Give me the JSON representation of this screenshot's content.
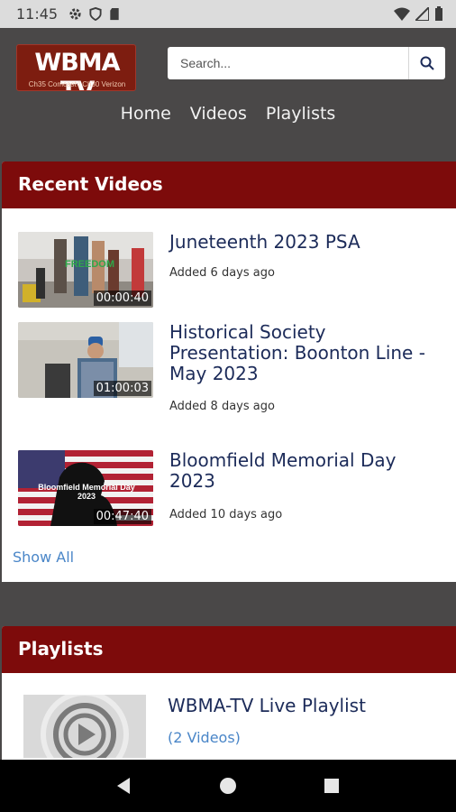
{
  "status_bar": {
    "time": "11:45"
  },
  "header": {
    "logo_text": "WBMA TV",
    "logo_subtitle": "Ch35 Comcast | Ch30 Verizon",
    "search_placeholder": "Search..."
  },
  "nav": {
    "items": [
      {
        "label": "Home"
      },
      {
        "label": "Videos"
      },
      {
        "label": "Playlists"
      }
    ]
  },
  "recent_videos": {
    "heading": "Recent Videos",
    "items": [
      {
        "title": "Juneteenth 2023 PSA",
        "duration": "00:00:40",
        "added": "Added 6 days ago",
        "thumb_caption": "FREEDOM"
      },
      {
        "title": "Historical Society Presentation: Boonton Line - May 2023",
        "duration": "01:00:03",
        "added": "Added 8 days ago"
      },
      {
        "title": "Bloomfield Memorial Day 2023",
        "duration": "00:47:40",
        "added": "Added 10 days ago",
        "thumb_caption": "Bloomfield Memorial Day 2023"
      }
    ],
    "show_all": "Show All"
  },
  "playlists": {
    "heading": "Playlists",
    "items": [
      {
        "title": "WBMA-TV Live Playlist",
        "count": "(2 Videos)"
      }
    ]
  },
  "colors": {
    "header_bg": "#4a4848",
    "card_header": "#7d0b0b",
    "title_text": "#1c2b59",
    "link": "#4a86c8"
  }
}
